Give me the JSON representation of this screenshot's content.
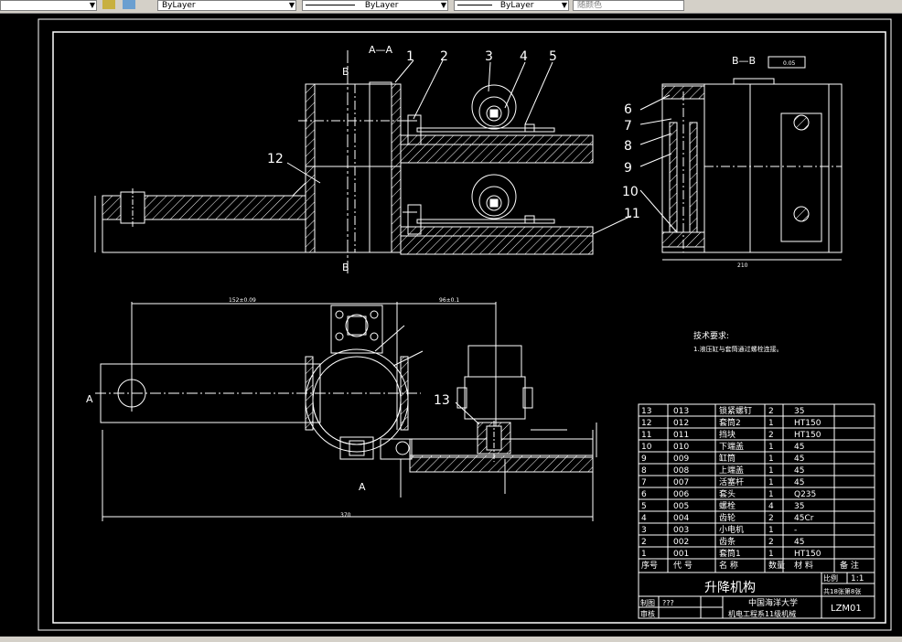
{
  "toolbar": {
    "layer_dropdown": "",
    "color_dropdown": "ByLayer",
    "linetype_dropdown": "ByLayer",
    "lineweight_dropdown": "ByLayer",
    "plotstyle_dropdown": "随颜色"
  },
  "drawing": {
    "section_a_label": "A—A",
    "section_b_label": "B—B",
    "section_b_top": "B",
    "section_b_bottom": "B",
    "flatness_tol": "0.05",
    "view_a_left": "A",
    "view_a_bottom": "A",
    "part_callouts": [
      "1",
      "2",
      "3",
      "4",
      "5",
      "6",
      "7",
      "8",
      "9",
      "10",
      "11",
      "12",
      "13"
    ],
    "dim_152": "152±0.09",
    "dim_96": "96±0.1",
    "dim_370": "370",
    "dim_210": "210",
    "tech_req_title": "技术要求:",
    "tech_req_item": "1.液压缸与套筒通过螺栓连接。"
  },
  "bom": {
    "rows": [
      [
        "13",
        "013",
        "锁紧螺钉",
        "2",
        "35"
      ],
      [
        "12",
        "012",
        "套筒2",
        "1",
        "HT150"
      ],
      [
        "11",
        "011",
        "挡块",
        "2",
        "HT150"
      ],
      [
        "10",
        "010",
        "下端盖",
        "1",
        "45"
      ],
      [
        "9",
        "009",
        "缸筒",
        "1",
        "45"
      ],
      [
        "8",
        "008",
        "上端盖",
        "1",
        "45"
      ],
      [
        "7",
        "007",
        "活塞杆",
        "1",
        "45"
      ],
      [
        "6",
        "006",
        "套头",
        "1",
        "Q235"
      ],
      [
        "5",
        "005",
        "螺栓",
        "4",
        "35"
      ],
      [
        "4",
        "004",
        "齿轮",
        "2",
        "45Cr"
      ],
      [
        "3",
        "003",
        "小电机",
        "1",
        "-"
      ],
      [
        "2",
        "002",
        "齿条",
        "2",
        "45"
      ],
      [
        "1",
        "001",
        "套筒1",
        "1",
        "HT150"
      ]
    ],
    "header": [
      "序号",
      "代 号",
      "名 称",
      "数量",
      "材 料",
      "备 注"
    ]
  },
  "titleblock": {
    "name": "升降机构",
    "scale_label": "比例",
    "scale_value": "1:1",
    "sheet": "共18张第8张",
    "school": "中国海洋大学",
    "class": "机电工程系11级机械",
    "drawing_no": "LZM01",
    "drawn_label": "制图",
    "drawn_value": "???",
    "checked_label": "审核"
  }
}
